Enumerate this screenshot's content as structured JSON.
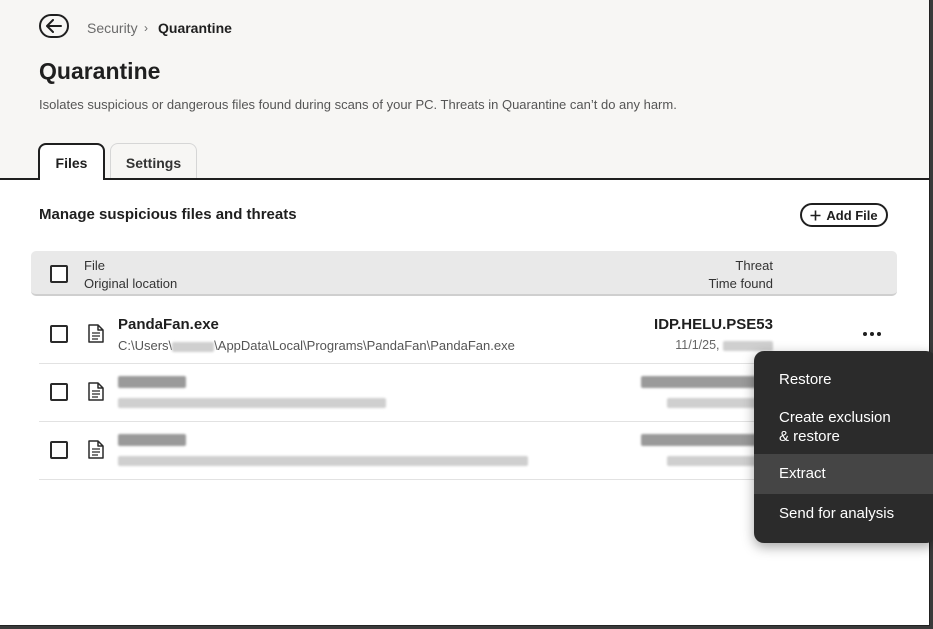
{
  "breadcrumb": {
    "parent": "Security",
    "separator": "›",
    "current": "Quarantine"
  },
  "page": {
    "title": "Quarantine",
    "subtitle": "Isolates suspicious or dangerous files found during scans of your PC. Threats in Quarantine can’t do any harm."
  },
  "tabs": [
    {
      "label": "Files",
      "active": true
    },
    {
      "label": "Settings",
      "active": false
    }
  ],
  "section": {
    "title": "Manage suspicious files and threats",
    "add_button": "Add File"
  },
  "table": {
    "headers": {
      "file": "File",
      "location": "Original location",
      "threat": "Threat",
      "time": "Time found"
    },
    "rows": [
      {
        "name": "PandaFan.exe",
        "location_prefix": "C:\\Users\\",
        "location_suffix": "\\AppData\\Local\\Programs\\PandaFan\\PandaFan.exe",
        "threat": "IDP.HELU.PSE53",
        "time": "11/1/25,"
      }
    ]
  },
  "context_menu": {
    "items": [
      "Restore",
      "Create exclusion",
      "& restore",
      "Extract",
      "Send for analysis"
    ],
    "highlighted": "Extract"
  },
  "colors": {
    "menu_bg": "#2b2b2b",
    "menu_hover": "#454545",
    "header_bg": "#f7f6f4",
    "table_head_bg": "#e9e9e9"
  }
}
